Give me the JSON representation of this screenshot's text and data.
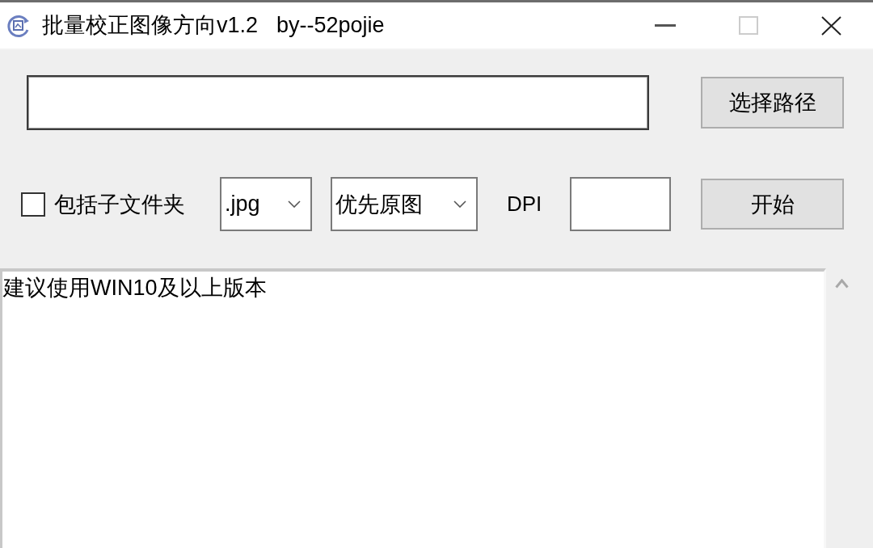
{
  "window": {
    "title": "批量校正图像方向v1.2  by--52pojie",
    "maximize": {
      "disabled": true
    }
  },
  "browse_button": {
    "label": "选择路径"
  },
  "include_subfolders": {
    "label": "包括子文件夹",
    "checked": false
  },
  "format_select": {
    "value": ".jpg"
  },
  "mode_select": {
    "value": "优先原图"
  },
  "dpi": {
    "label": "DPI"
  },
  "start_button": {
    "label": "开始"
  },
  "log": {
    "lines": [
      "建议使用WIN10及以上版本"
    ]
  }
}
